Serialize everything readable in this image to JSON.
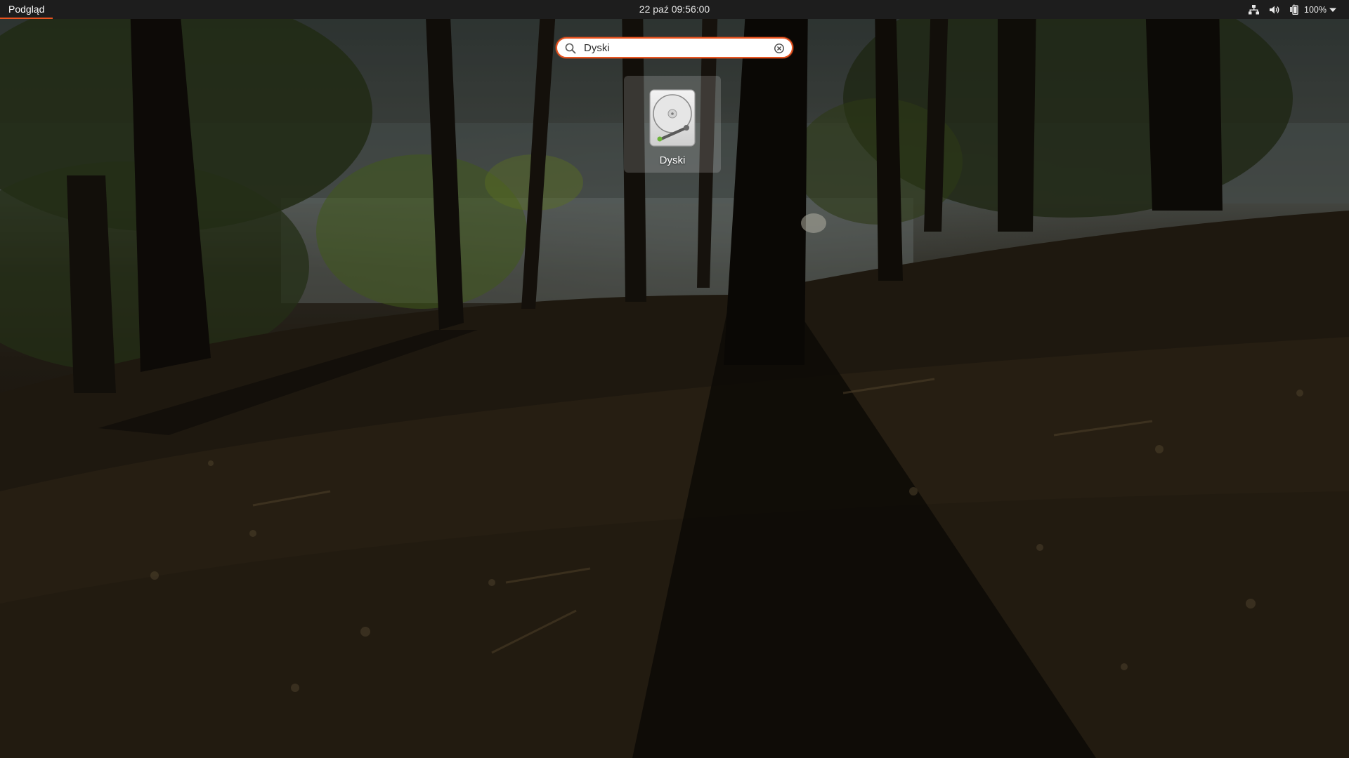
{
  "topbar": {
    "activities_label": "Podgląd",
    "clock": "22 paź  09:56:00",
    "battery_percent": "100%",
    "accent_color": "#e95420",
    "icons": [
      "network-icon",
      "volume-icon",
      "battery-icon",
      "dropdown-arrow-icon"
    ]
  },
  "search": {
    "value": "Dyski",
    "icons": [
      "search-icon",
      "clear-icon"
    ]
  },
  "results": [
    {
      "label": "Dyski",
      "icon": "disk-utility-icon"
    }
  ]
}
